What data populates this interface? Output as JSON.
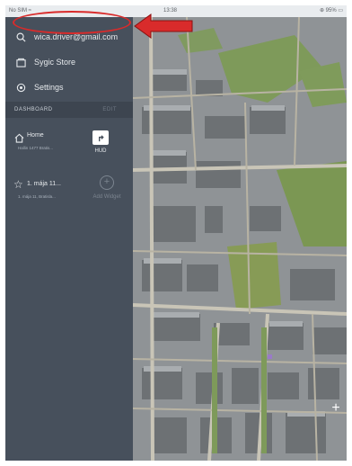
{
  "status_bar": {
    "carrier": "No SIM ≈",
    "time": "13:38",
    "right": "⊕ 95% ▭"
  },
  "sidebar": {
    "account_email": "wica.driver@gmail.com",
    "store_label": "Sygic Store",
    "settings_label": "Settings",
    "dashboard_label": "DASHBOARD",
    "edit_label": "EDIT"
  },
  "widgets": {
    "home_title": "Home",
    "home_sub": "Hallin 1477 Bratis...",
    "fav_title": "1. mája 11...",
    "fav_sub": "1. mája 11, Bratisla...",
    "hud_label": "HUD",
    "add_widget_label": "Add Widget"
  },
  "map": {
    "zoom_in_label": "+"
  },
  "colors": {
    "sidebar_bg": "#47505c",
    "annotation_red": "#d92b2b"
  },
  "icons": [
    "search-icon",
    "store-icon",
    "settings-icon",
    "home-icon",
    "star-icon",
    "hud-icon",
    "add-icon",
    "arrow-annotation"
  ]
}
